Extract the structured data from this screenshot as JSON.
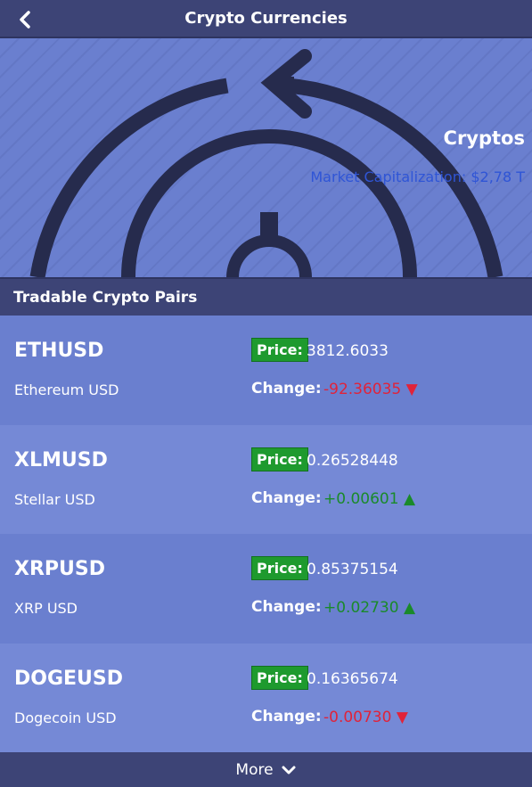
{
  "header": {
    "title": "Crypto Currencies"
  },
  "hero": {
    "title": "Cryptos",
    "subtitle": "Market Capitalization: $2,78 T"
  },
  "section": {
    "title": "Tradable Crypto Pairs"
  },
  "pairs": [
    {
      "symbol": "ETHUSD",
      "name": "Ethereum USD",
      "price_label": "Price:",
      "price": "3812.6033",
      "change_label": "Change:",
      "change": "-92.36035 ▼",
      "direction": "down"
    },
    {
      "symbol": "XLMUSD",
      "name": "Stellar USD",
      "price_label": "Price:",
      "price": "0.26528448",
      "change_label": "Change:",
      "change": "+0.00601 ▲",
      "direction": "up"
    },
    {
      "symbol": "XRPUSD",
      "name": "XRP USD",
      "price_label": "Price:",
      "price": "0.85375154",
      "change_label": "Change:",
      "change": "+0.02730 ▲",
      "direction": "up"
    },
    {
      "symbol": "DOGEUSD",
      "name": "Dogecoin USD",
      "price_label": "Price:",
      "price": "0.16365674",
      "change_label": "Change:",
      "change": "-0.00730 ▼",
      "direction": "down"
    }
  ],
  "footer": {
    "more_label": "More"
  },
  "colors": {
    "bar": "#3d4476",
    "accent": "#1e9a2e",
    "negative": "#e0233a",
    "positive": "#1a8a2a",
    "subtitle": "#2f55d6"
  },
  "icons": {
    "back": "chevron-left-icon",
    "more": "chevron-down-icon",
    "hero": "refresh-arrow-icon"
  }
}
